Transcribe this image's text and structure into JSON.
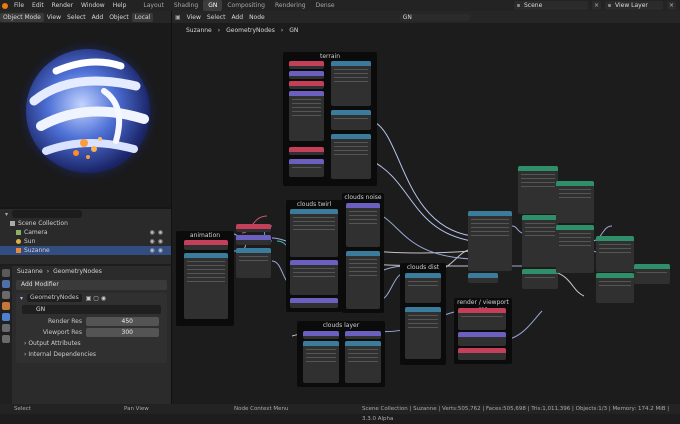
{
  "topbar": {
    "menus": [
      "File",
      "Edit",
      "Render",
      "Window",
      "Help"
    ],
    "tabs": [
      "Layout",
      "Shading",
      "GN",
      "Compositing",
      "Rendering",
      "Dense"
    ],
    "active_tab": "GN",
    "scene": "Scene",
    "view_layer": "View Layer"
  },
  "viewport": {
    "mode": "Object Mode",
    "menus": [
      "View",
      "Select",
      "Add",
      "Object"
    ],
    "orientation": "Local"
  },
  "outliner": {
    "collection": "Scene Collection",
    "items": [
      "Camera",
      "Sun",
      "Suzanne"
    ]
  },
  "properties": {
    "breadcrumb_object": "Suzanne",
    "breadcrumb_modifier": "GeometryNodes",
    "add_modifier": "Add Modifier",
    "modifier_name": "GeometryNodes",
    "node_group": "GN",
    "render_res_label": "Render Res",
    "render_res_value": "450",
    "viewport_res_label": "Viewport Res",
    "viewport_res_value": "300",
    "output_attributes": "Output Attributes",
    "internal_dependencies": "Internal Dependencies"
  },
  "node_editor": {
    "menus": [
      "View",
      "Select",
      "Add",
      "Node"
    ],
    "tree_name": "GN",
    "crumbs": [
      "Suzanne",
      "GeometryNodes",
      "GN"
    ],
    "frames": {
      "terrain": "terrain",
      "animation": "animation",
      "clouds_twirl": "clouds twirl",
      "clouds_noise": "clouds noise",
      "clouds_dist": "clouds dist",
      "render_viewport_res": "render / viewport res",
      "clouds_layer": "clouds layer"
    }
  },
  "statusbar": {
    "select": "Select",
    "pan": "Pan View",
    "context": "Node Context Menu",
    "stats": "Scene Collection | Suzanne | Verts:505,762 | Faces:505,698 | Tris:1,011,396 | Objects:1/3 | Memory: 174.2 MiB | 3.3.0 Alpha"
  }
}
